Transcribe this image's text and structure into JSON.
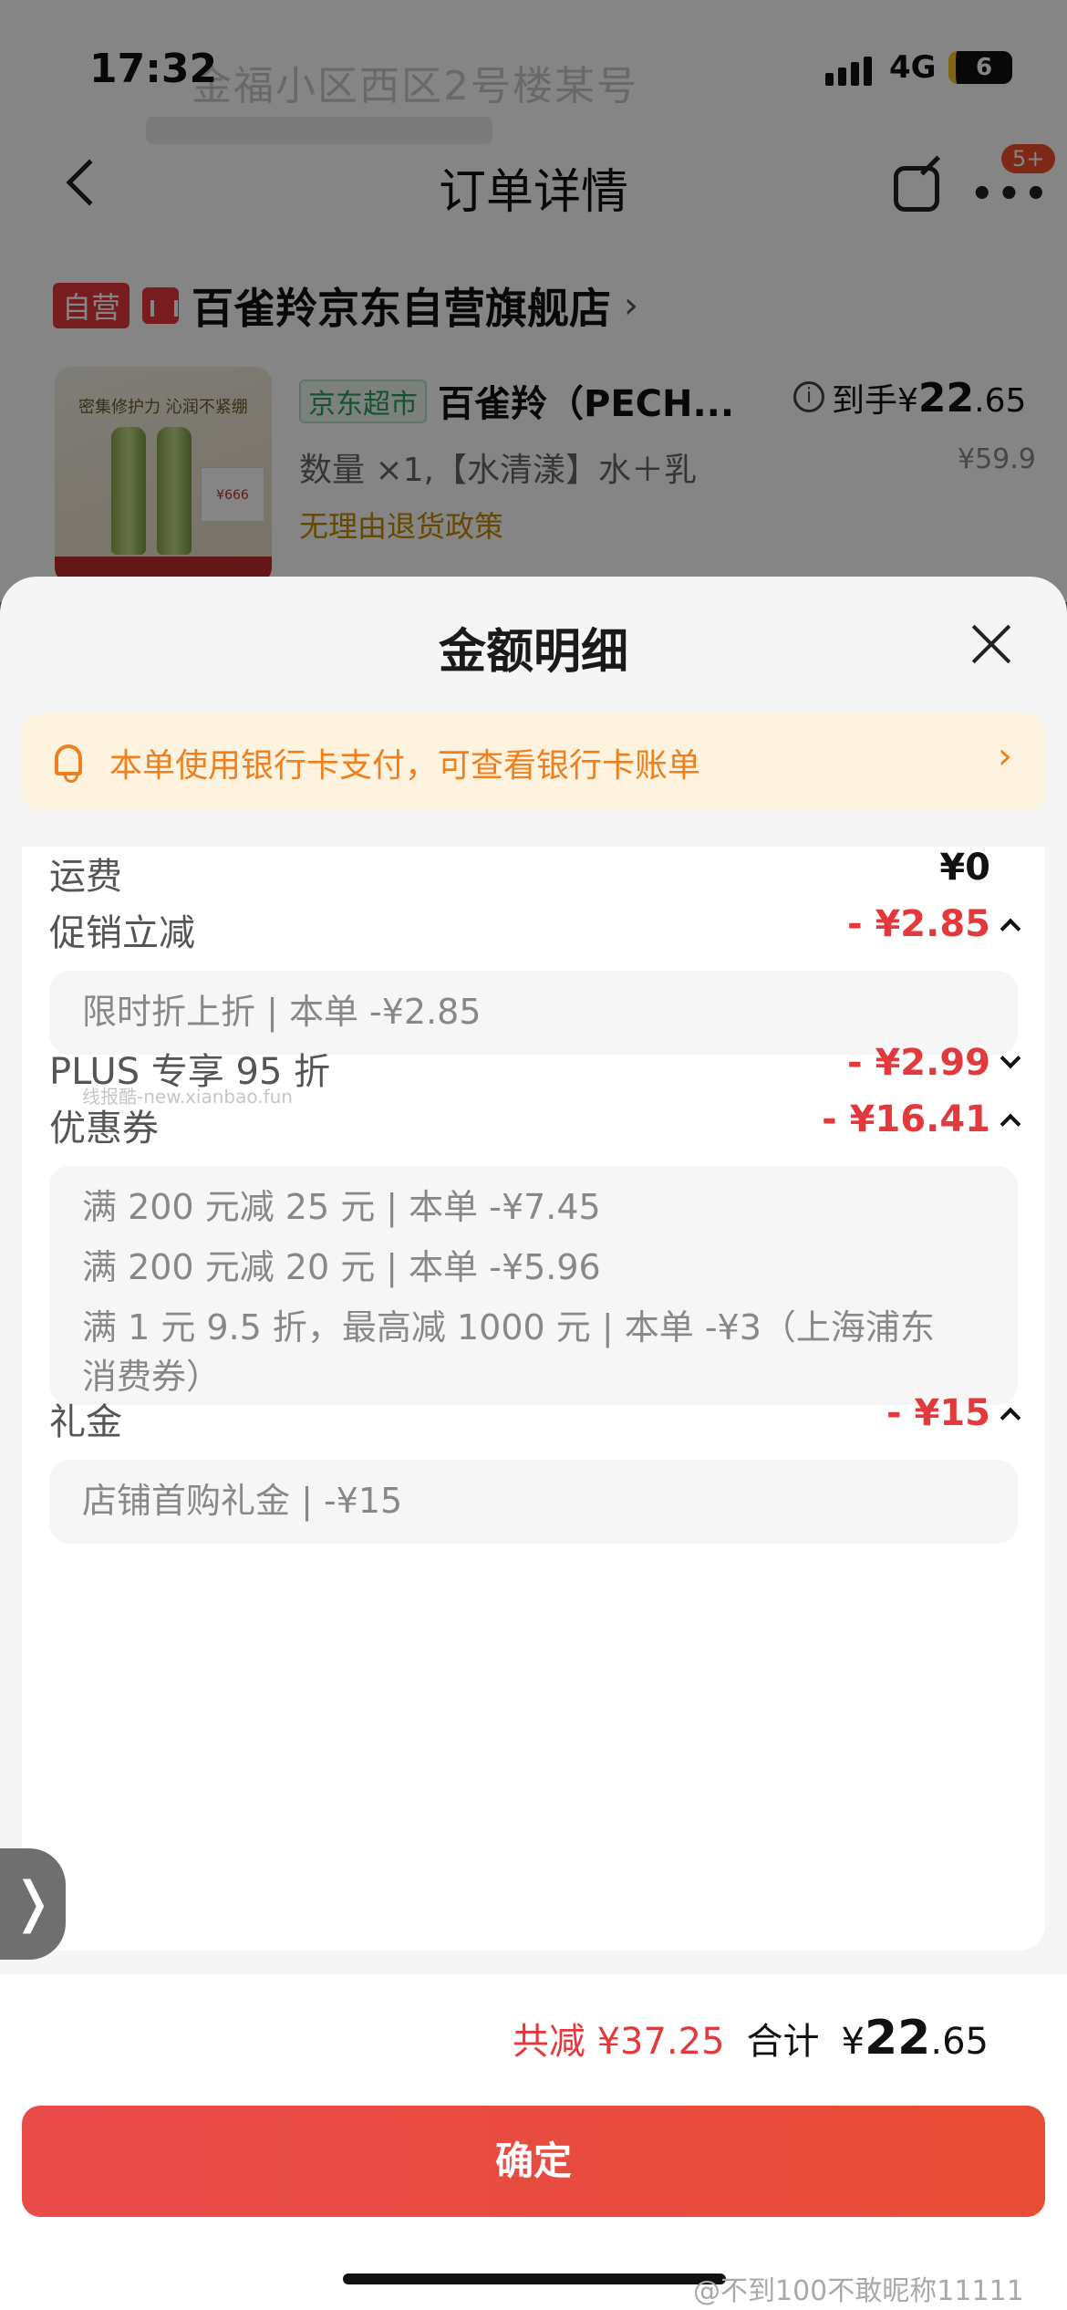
{
  "status": {
    "time": "17:32",
    "network": "4G",
    "battery": "6"
  },
  "background": {
    "address_ghost": "金福小区西区2号楼某号",
    "nav_title": "订单详情",
    "more_badge": "5+",
    "store": {
      "self_tag": "自营",
      "name": "百雀羚京东自营旗舰店",
      "chevron": "›"
    },
    "product": {
      "channel_tag": "京东超市",
      "name": "百雀羚（PECH...",
      "final_price_label": "到手¥",
      "final_price_int": "22",
      "final_price_dec": ".65",
      "orig_price": "¥59.9",
      "quantity_spec": "数量 ×1,【水清漾】水＋乳",
      "policy": "无理由退货政策",
      "image_text": "密集修护力 沁润不紧绷",
      "image_box_text": "¥666"
    }
  },
  "sheet": {
    "title": "金额明细",
    "notice": "本单使用银行卡支付，可查看银行卡账单",
    "notice_chevron": "›",
    "rows": {
      "shipping": {
        "label": "运费",
        "value": "¥0"
      },
      "promo": {
        "label": "促销立减",
        "value": "- ¥2.85",
        "detail": "限时折上折 | 本单 -¥2.85"
      },
      "plus": {
        "label": "PLUS 专享 95 折",
        "value": "- ¥2.99"
      },
      "coupon": {
        "label": "优惠券",
        "value": "- ¥16.41",
        "details": [
          "满 200 元减 25 元 | 本单 -¥7.45",
          "满 200 元减 20 元 | 本单 -¥5.96",
          "满 1 元 9.5 折，最高减 1000 元 | 本单 -¥3（上海浦东",
          "消费券）"
        ]
      },
      "gift": {
        "label": "礼金",
        "value": "- ¥15",
        "detail": "店铺首购礼金 | -¥15"
      }
    },
    "watermark": "线报酷-new.xianbao.fun"
  },
  "footer": {
    "saved": "共减 ¥37.25",
    "total_label": "合计",
    "total_currency": "¥",
    "total_int": "22",
    "total_dec": ".65",
    "confirm_label": "确定",
    "weibo_mark": "@不到100不敢昵称11111"
  },
  "side_tab": "❭",
  "colors": {
    "accent_red": "#e4393c",
    "notice_orange": "#f07f1e",
    "notice_bg": "#fef3df"
  }
}
